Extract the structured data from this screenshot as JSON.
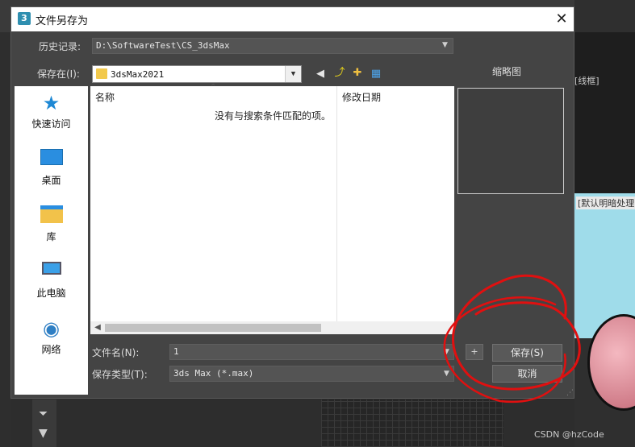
{
  "background": {
    "viewport_label": "[线框]",
    "render_label": "[默认明暗处理]",
    "top_icons": [
      "?",
      "L?",
      "%"
    ],
    "watermark": "CSDN @hzCode"
  },
  "dialog": {
    "title": "文件另存为",
    "title_icon": "3",
    "close": "✕",
    "history_label": "历史记录:",
    "history_value": "D:\\SoftwareTest\\CS_3dsMax",
    "save_in_label": "保存在(I):",
    "save_in_value": "3dsMax2021",
    "thumbnail_label": "缩略图",
    "places": [
      {
        "label": "快速访问",
        "icon": "star-icon"
      },
      {
        "label": "桌面",
        "icon": "desktop-icon"
      },
      {
        "label": "库",
        "icon": "library-icon"
      },
      {
        "label": "此电脑",
        "icon": "computer-icon"
      },
      {
        "label": "网络",
        "icon": "network-icon"
      }
    ],
    "columns": {
      "name": "名称",
      "date": "修改日期"
    },
    "empty_message": "没有与搜索条件匹配的项。",
    "file_name_label": "文件名(N):",
    "file_name_value": "1",
    "file_type_label": "保存类型(T):",
    "file_type_value": "3ds Max (*.max)",
    "plus_label": "+",
    "save_button": "保存(S)",
    "cancel_button": "取消"
  },
  "colors": {
    "dialog_bg": "#444444",
    "annotation": "#e01010"
  }
}
